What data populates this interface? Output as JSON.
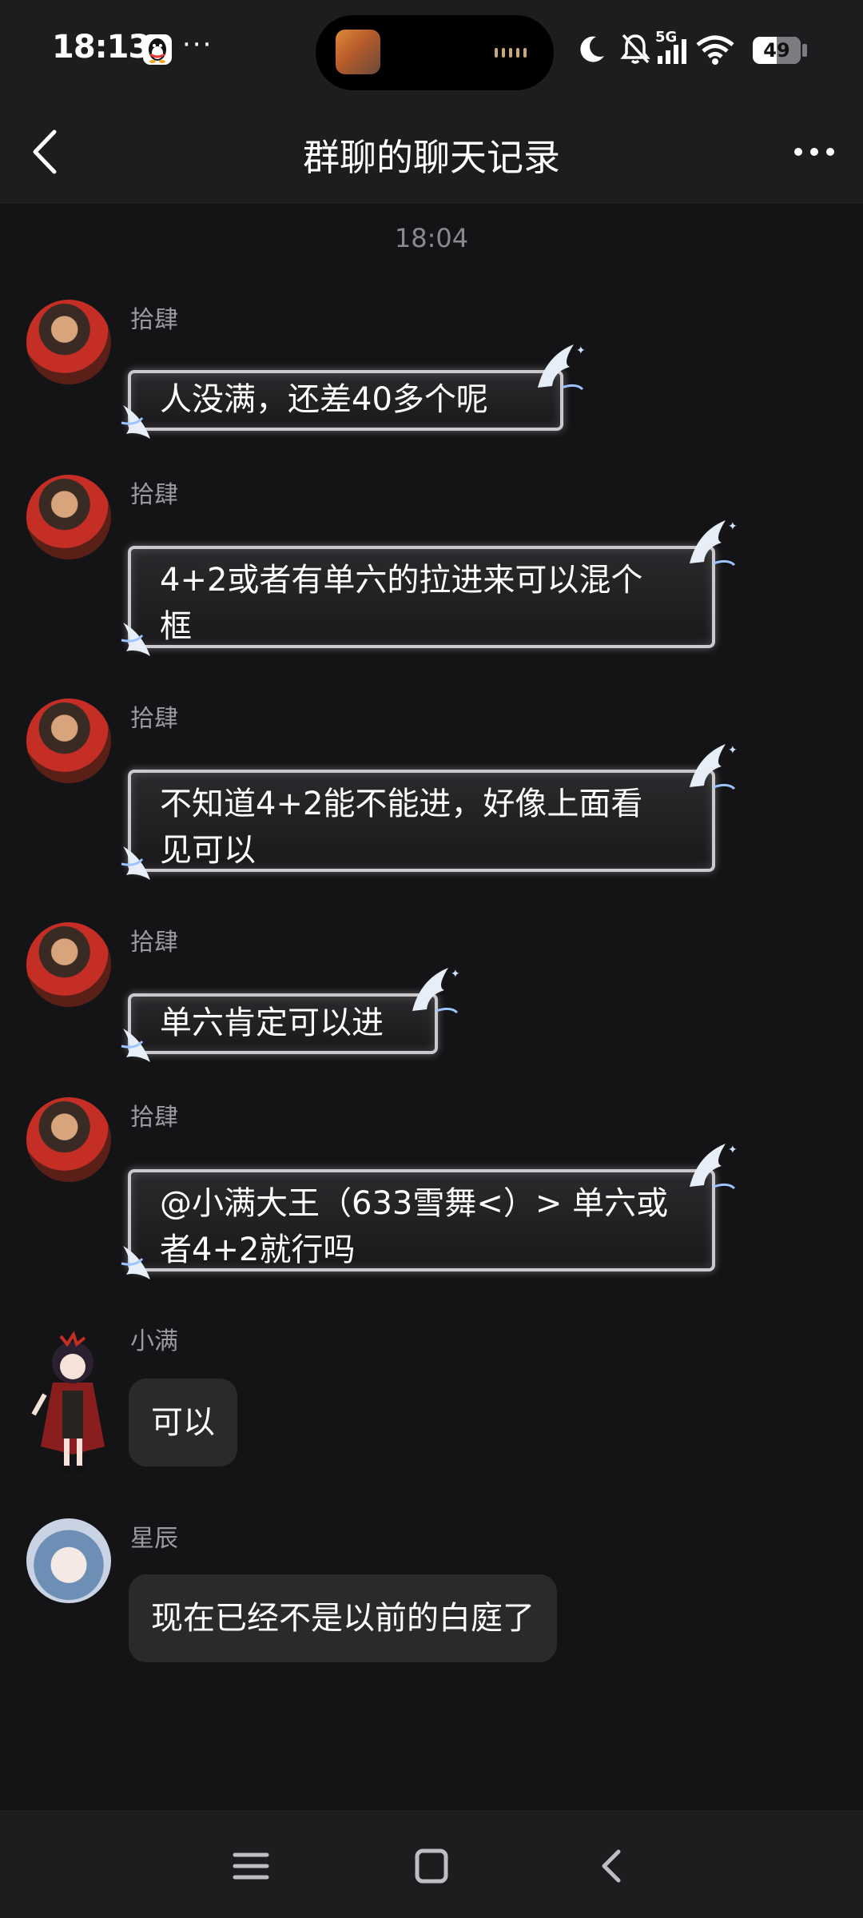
{
  "status_bar": {
    "time": "18:13",
    "qq_icon": "qq-penguin-icon",
    "more_dots": "···",
    "network": "5G",
    "battery": "49"
  },
  "nav": {
    "title": "群聊的聊天记录",
    "back_icon": "chevron-left-icon",
    "more_icon": "more-horizontal-icon"
  },
  "chat": {
    "timestamp": "18:04",
    "messages": [
      {
        "sender": "拾肆",
        "text": "人没满，还差40多个呢"
      },
      {
        "sender": "拾肆",
        "text": "4+2或者有单六的拉进来可以混个框"
      },
      {
        "sender": "拾肆",
        "text": "不知道4+2能不能进，好像上面看见可以"
      },
      {
        "sender": "拾肆",
        "text": "单六肯定可以进"
      },
      {
        "sender": "拾肆",
        "text": "@小满大王（633雪舞<）> 单六或者4+2就行吗"
      },
      {
        "sender": "小满",
        "text": "可以"
      },
      {
        "sender": "星辰",
        "text": "现在已经不是以前的白庭了"
      }
    ]
  },
  "bottom_nav": {
    "menu_icon": "menu-icon",
    "home_icon": "square-home-icon",
    "back_icon": "triangle-back-icon"
  }
}
